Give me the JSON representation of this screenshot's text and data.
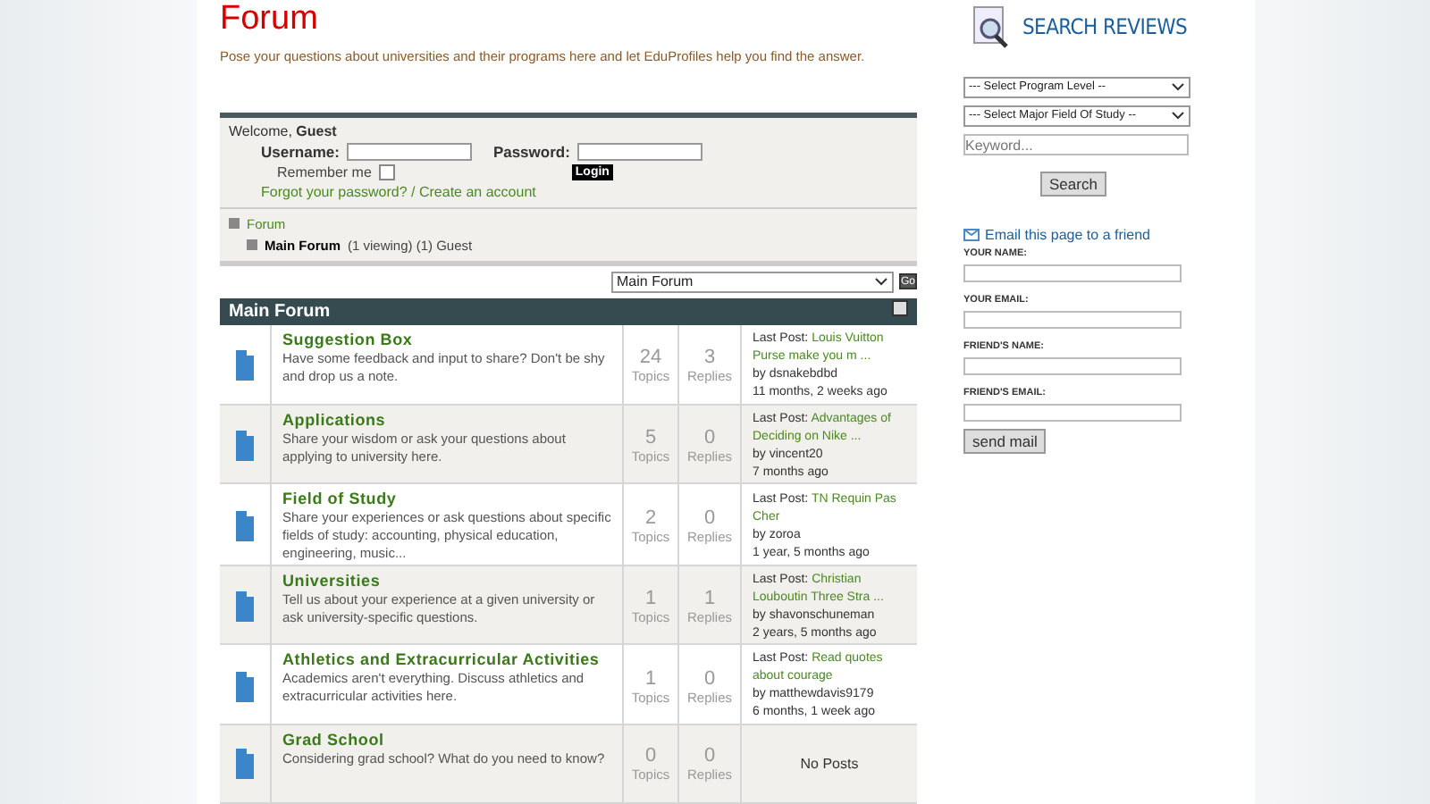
{
  "page": {
    "title": "Forum",
    "intro": "Pose your questions about universities and their programs here and let EduProfiles help you find the answer."
  },
  "login": {
    "welcome": "Welcome, ",
    "user": "Guest",
    "username_label": "Username:",
    "password_label": "Password:",
    "remember_label": "Remember me",
    "remember_checked": false,
    "login_button": "Login",
    "forgot_link": "Forgot your password? / Create an account"
  },
  "breadcrumb": {
    "root": "Forum",
    "current": "Main Forum",
    "viewing": "(1 viewing) (1) Guest"
  },
  "jump": {
    "value": "Main Forum",
    "go": "Go"
  },
  "section": {
    "title": "Main Forum"
  },
  "forums": [
    {
      "title": "Suggestion Box",
      "description": "Have some feedback and input to share? Don't be shy and drop us a note.",
      "topics": "24",
      "topics_label": "Topics",
      "replies": "3",
      "replies_label": "Replies",
      "last_post": {
        "label": "Last Post:",
        "topic": "Louis Vuitton Purse make you m ...",
        "by": "by dsnakebdbd",
        "ago": "11 months, 2 weeks ago"
      }
    },
    {
      "title": "Applications",
      "description": "Share your wisdom or ask your questions about applying to university here.",
      "topics": "5",
      "topics_label": "Topics",
      "replies": "0",
      "replies_label": "Replies",
      "last_post": {
        "label": "Last Post:",
        "topic": "Advantages of Deciding on Nike ...",
        "by": "by vincent20",
        "ago": "7 months ago"
      }
    },
    {
      "title": "Field of Study",
      "description": "Share your experiences or ask questions about specific fields of study: accounting, physical education, engineering, music...",
      "topics": "2",
      "topics_label": "Topics",
      "replies": "0",
      "replies_label": "Replies",
      "last_post": {
        "label": "Last Post:",
        "topic": "TN Requin Pas Cher",
        "by": "by zoroa",
        "ago": "1 year, 5 months ago"
      }
    },
    {
      "title": "Universities",
      "description": "Tell us about your experience at a given university or ask university-specific questions.",
      "topics": "1",
      "topics_label": "Topics",
      "replies": "1",
      "replies_label": "Replies",
      "last_post": {
        "label": "Last Post:",
        "topic": "Christian Louboutin Three Stra ...",
        "by": "by shavonschuneman",
        "ago": "2 years, 5 months ago"
      }
    },
    {
      "title": "Athletics and Extracurricular Activities",
      "description": "Academics aren't everything. Discuss athletics and extracurricular activities here.",
      "topics": "1",
      "topics_label": "Topics",
      "replies": "0",
      "replies_label": "Replies",
      "last_post": {
        "label": "Last Post:",
        "topic": "Read quotes about courage",
        "by": "by matthewdavis9179",
        "ago": "6 months, 1 week ago"
      }
    },
    {
      "title": "Grad School",
      "description": "Considering grad school? What do you need to know?",
      "topics": "0",
      "topics_label": "Topics",
      "replies": "0",
      "replies_label": "Replies",
      "no_posts": "No Posts"
    }
  ],
  "sidebar": {
    "heading": "SEARCH REVIEWS",
    "program_select": "--- Select Program Level --",
    "field_select": "--- Select Major Field Of Study --",
    "keyword_placeholder": "Keyword...",
    "search_button": "Search",
    "email_link": "Email this page to a friend",
    "fields": [
      "YOUR NAME:",
      "YOUR EMAIL:",
      "FRIEND'S NAME:",
      "FRIEND'S EMAIL:"
    ],
    "send_button": "send mail"
  }
}
